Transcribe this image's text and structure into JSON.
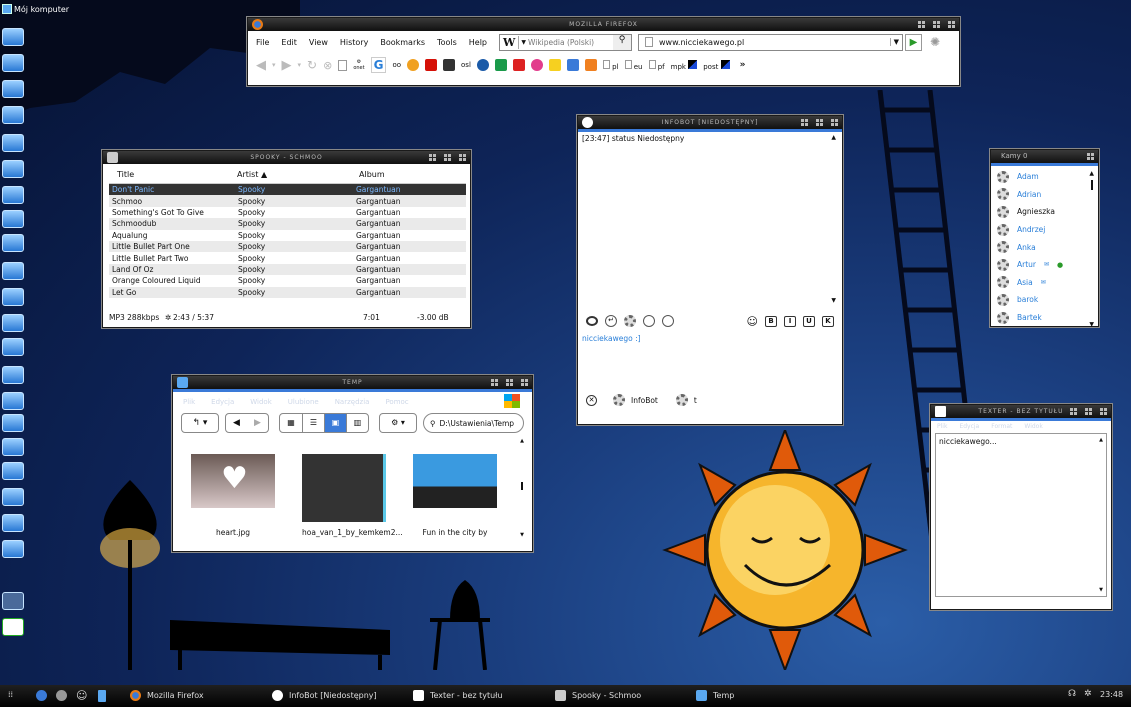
{
  "desktop": {
    "my_computer": "Mój komputer"
  },
  "firefox": {
    "title": "Mozilla Firefox",
    "menu": [
      "File",
      "Edit",
      "View",
      "History",
      "Bookmarks",
      "Tools",
      "Help"
    ],
    "search_engine_letter": "W",
    "search_placeholder": "Wikipedia (Polski)",
    "url": "www.nicciekawego.pl",
    "bookmarks": [
      "onet",
      "oo",
      "osl",
      "pl",
      "eu",
      "pf",
      "mpk",
      "post"
    ],
    "overflow": "»"
  },
  "player": {
    "title": "Spooky - Schmoo",
    "columns": [
      "Title",
      "Artist",
      "Album"
    ],
    "rows": [
      [
        "Don't Panic",
        "Spooky",
        "Gargantuan"
      ],
      [
        "Schmoo",
        "Spooky",
        "Gargantuan"
      ],
      [
        "Something's Got To Give",
        "Spooky",
        "Gargantuan"
      ],
      [
        "Schmoodub",
        "Spooky",
        "Gargantuan"
      ],
      [
        "Aqualung",
        "Spooky",
        "Gargantuan"
      ],
      [
        "Little Bullet Part One",
        "Spooky",
        "Gargantuan"
      ],
      [
        "Little Bullet Part Two",
        "Spooky",
        "Gargantuan"
      ],
      [
        "Land Of Oz",
        "Spooky",
        "Gargantuan"
      ],
      [
        "Orange Coloured Liquid",
        "Spooky",
        "Gargantuan"
      ],
      [
        "Let Go",
        "Spooky",
        "Gargantuan"
      ]
    ],
    "status_format": "MP3 288kbps",
    "status_time": "2:43 / 5:37",
    "status_total": "7:01",
    "status_gain": "-3.00 dB"
  },
  "infobot": {
    "title": "InfoBot [Niedostępny]",
    "log": "[23:47] status Niedostępny",
    "input": "nicciekawego :]",
    "bot_name": "InfoBot",
    "bot_status": "t",
    "fmt": [
      "B",
      "I",
      "U",
      "K"
    ]
  },
  "contacts": {
    "title": "Kamy 0",
    "items": [
      {
        "name": "Adam",
        "online": true
      },
      {
        "name": "Adrian",
        "online": true
      },
      {
        "name": "Agnieszka",
        "online": false
      },
      {
        "name": "Andrzej",
        "online": true
      },
      {
        "name": "Anka",
        "online": true
      },
      {
        "name": "Artur",
        "online": true
      },
      {
        "name": "Asia",
        "online": true
      },
      {
        "name": "barok",
        "online": true
      },
      {
        "name": "Bartek",
        "online": true
      }
    ]
  },
  "explorer": {
    "title": "Temp",
    "menu": [
      "Plik",
      "Edycja",
      "Widok",
      "Ulubione",
      "Narzędzia",
      "Pomoc"
    ],
    "path": "D:\\Ustawienia\\Temp",
    "files": [
      "heart.jpg",
      "hoa_van_1_by_kemkem2...",
      "Fun in the city by"
    ]
  },
  "texter": {
    "title": "Texter - bez tytułu",
    "menu": [
      "Plik",
      "Edycja",
      "Format",
      "Widok"
    ],
    "content": "nicciekawego..."
  },
  "taskbar": {
    "tasks": [
      "Mozilla Firefox",
      "InfoBot [Niedostępny]",
      "Texter - bez tytułu",
      "Spooky - Schmoo",
      "Temp"
    ],
    "clock": "23:48"
  },
  "colors": {
    "accent": "#3a7ad8",
    "link": "#2a7fd8",
    "titlebar": "#1a1a1a"
  }
}
